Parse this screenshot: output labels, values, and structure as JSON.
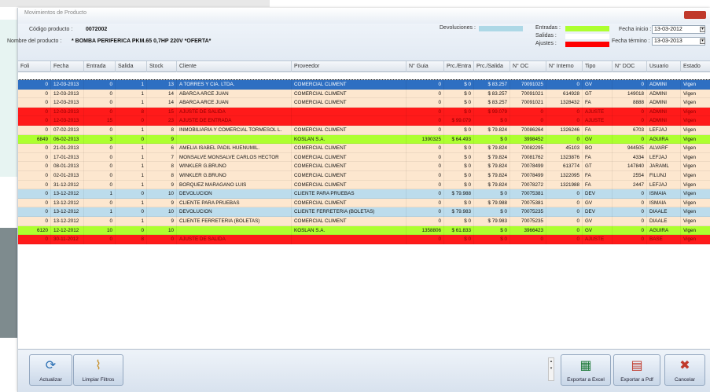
{
  "window": {
    "title": "Movimientos de Producto"
  },
  "header": {
    "codigo_label": "Código producto :",
    "codigo_value": "0072002",
    "nombre_label": "Nombre del producto :",
    "nombre_value": "* BOMBA PERIFERICA PKM.65 0,7HP 220V *OFERTA*",
    "devoluciones_label": "Devoluciones :",
    "entradas_label": "Entradas :",
    "salidas_label": "Salidas :",
    "ajustes_label": "Ajustes :",
    "fecha_inicio_label": "Fecha inicio :",
    "fecha_inicio_value": "13-03-2012",
    "fecha_termino_label": "Fecha término :",
    "fecha_termino_value": "13-03-2013"
  },
  "legend_colors": {
    "devoluciones": "#add8e6",
    "entradas": "#adff2f",
    "salidas": "#ffffff",
    "ajustes": "#ff0000"
  },
  "columns": [
    "Foli",
    "Fecha",
    "Entrada",
    "Salida",
    "Stock",
    "Cliente",
    "Proveedor",
    "N° Guia",
    "Prc./Entra",
    "Prc./Salida",
    "N° OC",
    "N° Interno",
    "Tipo",
    "N° DOC",
    "Usuario",
    "Estado"
  ],
  "rows": [
    {
      "type": "selected",
      "cells": [
        "0",
        "12-03-2013",
        "0",
        "1",
        "13",
        "A TORRES Y CIA. LTDA.",
        "COMERCIAL CLIMENT",
        "0",
        "$ 0",
        "$ 83.257",
        "70091025",
        "0",
        "GV",
        "0",
        "ADMINI",
        "Vigen"
      ]
    },
    {
      "type": "salida",
      "cells": [
        "0",
        "12-03-2013",
        "0",
        "1",
        "14",
        "ABARCA ARCE JUAN",
        "COMERCIAL CLIMENT",
        "0",
        "$ 0",
        "$ 83.257",
        "70091021",
        "614928",
        "GT",
        "149018",
        "ADMINI",
        "Vigen"
      ]
    },
    {
      "type": "salida",
      "cells": [
        "0",
        "12-03-2013",
        "0",
        "1",
        "14",
        "ABARCA ARCE JUAN",
        "COMERCIAL CLIMENT",
        "0",
        "$ 0",
        "$ 83.257",
        "70091021",
        "1328432",
        "FA",
        "8888",
        "ADMINI",
        "Vigen"
      ]
    },
    {
      "type": "ajuste",
      "cells": [
        "0",
        "12-03-2013",
        "0",
        "8",
        "15",
        "AJUSTE DE SALIDA",
        "",
        "0",
        "$ 0",
        "$ 99.079",
        "0",
        "0",
        "AJUSTE",
        "0",
        "ADMINI",
        "Vigen"
      ]
    },
    {
      "type": "ajuste",
      "cells": [
        "0",
        "12-03-2013",
        "15",
        "0",
        "23",
        "AJUSTE DE ENTRADA",
        "",
        "0",
        "$ 99.079",
        "$ 0",
        "0",
        "0",
        "AJUSTE",
        "0",
        "ADMINI",
        "Vigen"
      ]
    },
    {
      "type": "salida",
      "cells": [
        "0",
        "07-02-2013",
        "0",
        "1",
        "8",
        "INMOBILIARIA Y COMERCIAL TORMESOL L.",
        "COMERCIAL CLIMENT",
        "0",
        "$ 0",
        "$ 79.824",
        "70086264",
        "1326246",
        "FA",
        "6703",
        "LEFJAJ",
        "Vigen"
      ]
    },
    {
      "type": "entrada",
      "cells": [
        "6849",
        "06-02-2013",
        "3",
        "0",
        "9",
        "",
        "KOSLAN S.A.",
        "1390325",
        "$ 64.493",
        "$ 0",
        "3998452",
        "0",
        "GV",
        "0",
        "AGUIRA",
        "Vigen"
      ]
    },
    {
      "type": "salida",
      "cells": [
        "0",
        "21-01-2013",
        "0",
        "1",
        "6",
        "AMELIA ISABEL PADIL HUENUMIL.",
        "COMERCIAL CLIMENT",
        "0",
        "$ 0",
        "$ 79.824",
        "70082295",
        "45103",
        "BO",
        "944505",
        "ALVARF",
        "Vigen"
      ]
    },
    {
      "type": "salida",
      "cells": [
        "0",
        "17-01-2013",
        "0",
        "1",
        "7",
        "MONSALVE MONSALVE CARLOS HECTOR",
        "COMERCIAL CLIMENT",
        "0",
        "$ 0",
        "$ 79.824",
        "70081762",
        "1323876",
        "FA",
        "4334",
        "LEFJAJ",
        "Vigen"
      ]
    },
    {
      "type": "salida",
      "cells": [
        "0",
        "08-01-2013",
        "0",
        "1",
        "8",
        "WINKLER G.BRUNO",
        "COMERCIAL CLIMENT",
        "0",
        "$ 0",
        "$ 79.824",
        "70078499",
        "613774",
        "GT",
        "147840",
        "JARAML",
        "Vigen"
      ]
    },
    {
      "type": "salida",
      "cells": [
        "0",
        "02-01-2013",
        "0",
        "1",
        "8",
        "WINKLER G.BRUNO",
        "COMERCIAL CLIMENT",
        "0",
        "$ 0",
        "$ 79.824",
        "70078499",
        "1322095",
        "FA",
        "2554",
        "FILUNJ",
        "Vigen"
      ]
    },
    {
      "type": "salida",
      "cells": [
        "0",
        "31-12-2012",
        "0",
        "1",
        "9",
        "BORQUEZ MARAGANO LUIS",
        "COMERCIAL CLIMENT",
        "0",
        "$ 0",
        "$ 79.824",
        "70078272",
        "1321988",
        "FA",
        "2447",
        "LEFJAJ",
        "Vigen"
      ]
    },
    {
      "type": "devolucion",
      "cells": [
        "0",
        "13-12-2012",
        "1",
        "0",
        "10",
        "DEVOLUCION",
        "CLIENTE PARA PRUEBAS",
        "0",
        "$ 79.988",
        "$ 0",
        "70075381",
        "0",
        "DEV",
        "0",
        "ISMAIA",
        "Vigen"
      ]
    },
    {
      "type": "salida",
      "cells": [
        "0",
        "13-12-2012",
        "0",
        "1",
        "9",
        "CLIENTE PARA PRUEBAS",
        "COMERCIAL CLIMENT",
        "0",
        "$ 0",
        "$ 79.988",
        "70075381",
        "0",
        "GV",
        "0",
        "ISMAIA",
        "Vigen"
      ]
    },
    {
      "type": "devolucion",
      "cells": [
        "0",
        "13-12-2012",
        "1",
        "0",
        "10",
        "DEVOLUCION",
        "CLIENTE FERRETERIA (BOLETAS)",
        "0",
        "$ 79.983",
        "$ 0",
        "70075235",
        "0",
        "DEV",
        "0",
        "DIAALE",
        "Vigen"
      ]
    },
    {
      "type": "salida",
      "cells": [
        "0",
        "13-12-2012",
        "0",
        "1",
        "9",
        "CLIENTE FERRETERIA (BOLETAS)",
        "COMERCIAL CLIMENT",
        "0",
        "$ 0",
        "$ 79.983",
        "70075235",
        "0",
        "GV",
        "0",
        "DIAALE",
        "Vigen"
      ]
    },
    {
      "type": "entrada",
      "cells": [
        "6120",
        "12-12-2012",
        "10",
        "0",
        "10",
        "",
        "KOSLAN S.A.",
        "1358806",
        "$ 61.833",
        "$ 0",
        "3966423",
        "0",
        "GV",
        "0",
        "AGUIRA",
        "Vigen"
      ]
    },
    {
      "type": "ajuste",
      "cells": [
        "0",
        "30-11-2012",
        "0",
        "8",
        "0",
        "AJUSTE DE SALIDA",
        "",
        "0",
        "$ 0",
        "$ 0",
        "0",
        "0",
        "AJUSTE",
        "0",
        "BASE",
        "Vigen"
      ]
    }
  ],
  "toolbar": {
    "actualizar": "Actualizar",
    "limpiar": "Limpiar Filtros",
    "excel": "Exportar a Excel",
    "pdf": "Exportar a Pdf",
    "cancelar": "Cancelar"
  },
  "icons": {
    "actualizar": "refresh-icon",
    "limpiar": "broom-icon",
    "excel": "excel-icon",
    "pdf": "pdf-icon",
    "cancelar": "close-icon"
  }
}
